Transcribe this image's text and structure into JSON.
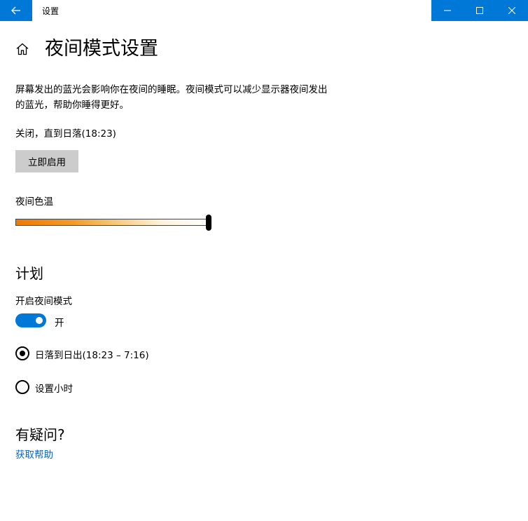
{
  "window": {
    "title": "设置"
  },
  "header": {
    "title": "夜间模式设置"
  },
  "description": "屏幕发出的蓝光会影响你在夜间的睡眠。夜间模式可以减少显示器夜间发出的蓝光，帮助你睡得更好。",
  "status_text": "关闭，直到日落(18:23)",
  "enable_button_label": "立即启用",
  "color_temp": {
    "label": "夜间色温",
    "value": 1.0
  },
  "schedule": {
    "title": "计划",
    "toggle_label": "开启夜间模式",
    "toggle_state": "开",
    "options": [
      {
        "label": "日落到日出(18:23 – 7:16)",
        "selected": true
      },
      {
        "label": "设置小时",
        "selected": false
      }
    ]
  },
  "help": {
    "title": "有疑问?",
    "link_label": "获取帮助"
  },
  "colors": {
    "accent": "#0078d7",
    "link": "#0066cc"
  }
}
